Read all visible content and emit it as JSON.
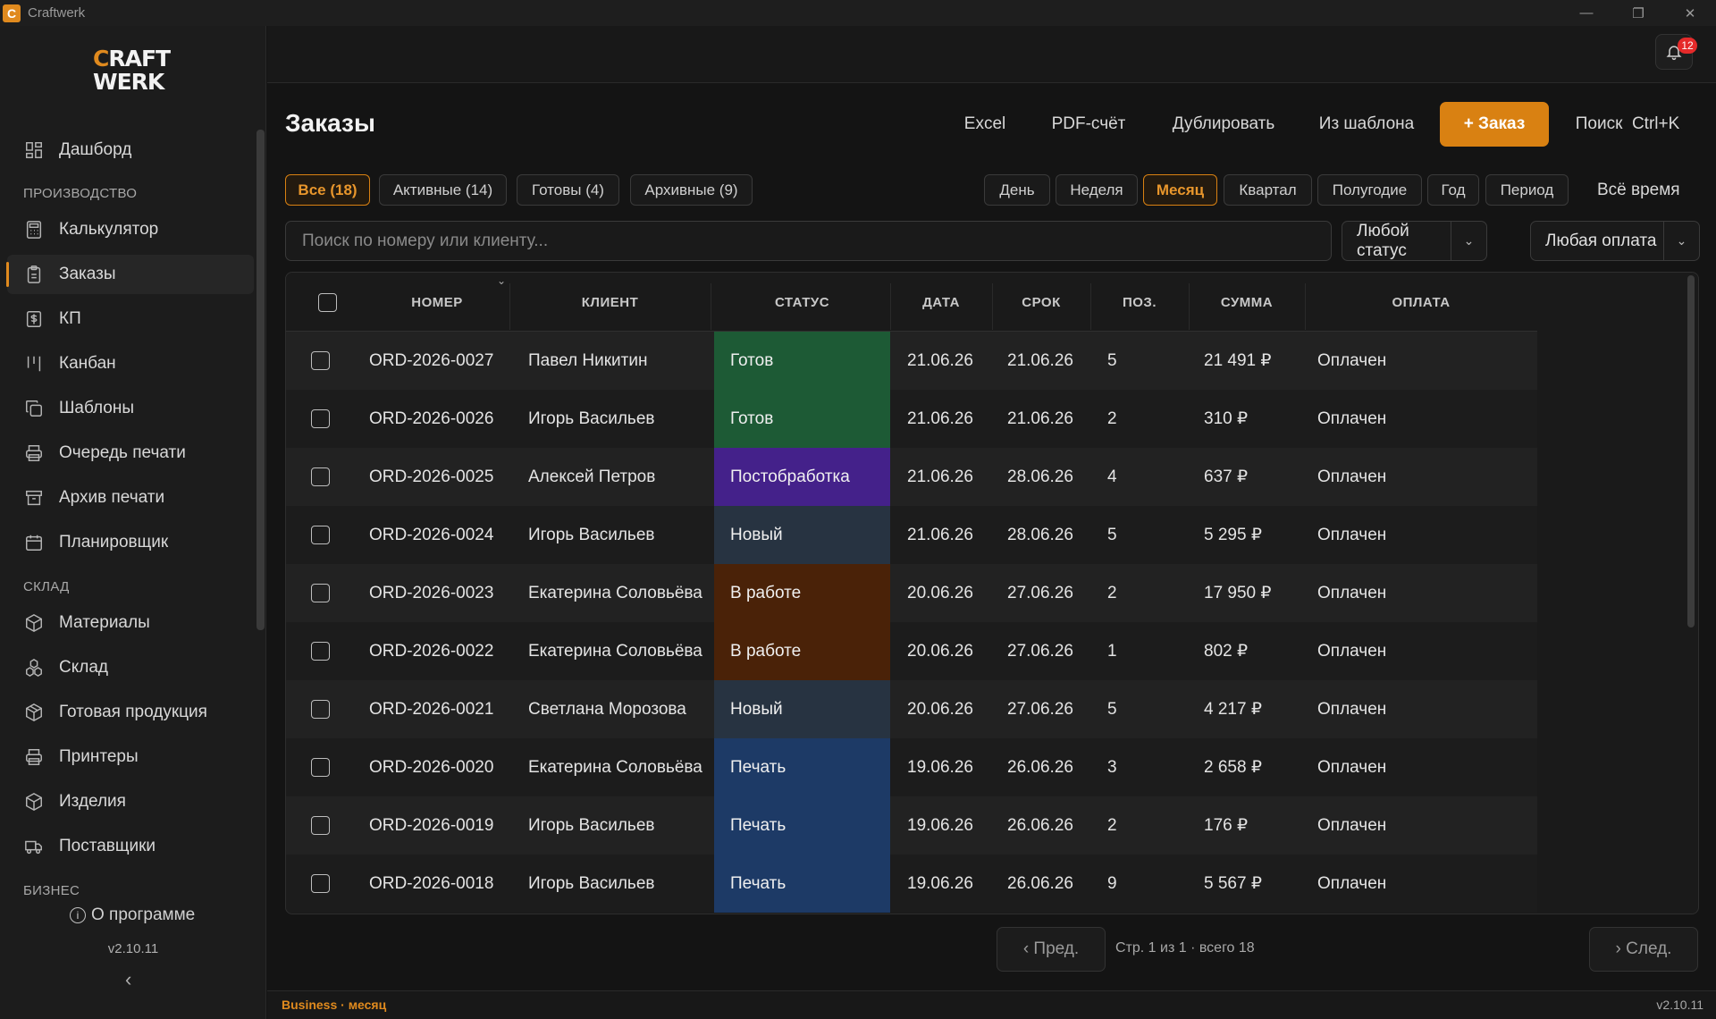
{
  "app": {
    "title": "Craftwerk",
    "icon_letter": "C"
  },
  "window_controls": {
    "minimize": "—",
    "maximize": "❐",
    "close": "✕"
  },
  "logo": {
    "line1_accent": "C",
    "line1_rest": "RAFT",
    "line2": "WERK"
  },
  "sidebar": {
    "dashboard": "Дашборд",
    "sections": {
      "production": "ПРОИЗВОДСТВО",
      "warehouse": "СКЛАД",
      "business": "БИЗНЕС"
    },
    "items": [
      {
        "label": "Калькулятор",
        "icon": "calculator-icon"
      },
      {
        "label": "Заказы",
        "icon": "clipboard-icon",
        "active": true
      },
      {
        "label": "КП",
        "icon": "dollar-doc-icon"
      },
      {
        "label": "Канбан",
        "icon": "kanban-icon"
      },
      {
        "label": "Шаблоны",
        "icon": "copy-icon"
      },
      {
        "label": "Очередь печати",
        "icon": "printer-icon"
      },
      {
        "label": "Архив печати",
        "icon": "archive-icon"
      },
      {
        "label": "Планировщик",
        "icon": "calendar-icon"
      },
      {
        "label": "Материалы",
        "icon": "box-icon"
      },
      {
        "label": "Склад",
        "icon": "boxes-icon"
      },
      {
        "label": "Готовая продукция",
        "icon": "package-icon"
      },
      {
        "label": "Принтеры",
        "icon": "printer-icon"
      },
      {
        "label": "Изделия",
        "icon": "cube-icon"
      },
      {
        "label": "Поставщики",
        "icon": "truck-icon"
      }
    ],
    "about": "О программе",
    "version": "v2.10.11"
  },
  "notifications": {
    "count": "12"
  },
  "header": {
    "title": "Заказы",
    "actions": {
      "excel": "Excel",
      "pdf": "PDF-счёт",
      "duplicate": "Дублировать",
      "from_template": "Из шаблона",
      "new_order": "+ Заказ",
      "search": "Поиск  Ctrl+K"
    }
  },
  "filters": {
    "tabs": [
      "Все (18)",
      "Активные (14)",
      "Готовы (4)",
      "Архивные (9)"
    ],
    "active_tab": "Все (18)",
    "periods": [
      "День",
      "Неделя",
      "Месяц",
      "Квартал",
      "Полугодие",
      "Год",
      "Период"
    ],
    "active_period": "Месяц",
    "all_time": "Всё время"
  },
  "search": {
    "placeholder": "Поиск по номеру или клиенту..."
  },
  "status_select": {
    "value": "Любой статус"
  },
  "payment_select": {
    "value": "Любая оплата"
  },
  "table": {
    "columns": [
      "НОМЕР",
      "КЛИЕНТ",
      "СТАТУС",
      "ДАТА",
      "СРОК",
      "ПОЗ.",
      "СУММА",
      "ОПЛАТА"
    ],
    "status_colors": {
      "Готов": "#1d5a35",
      "Постобработка": "#44218a",
      "Новый": "#273341",
      "В работе": "#4a2208",
      "Печать": "#1d3a66"
    },
    "rows": [
      {
        "number": "ORD-2026-0027",
        "client": "Павел Никитин",
        "status": "Готов",
        "date": "21.06.26",
        "due": "21.06.26",
        "pos": "5",
        "sum": "21 491 ₽",
        "payment": "Оплачен"
      },
      {
        "number": "ORD-2026-0026",
        "client": "Игорь Васильев",
        "status": "Готов",
        "date": "21.06.26",
        "due": "21.06.26",
        "pos": "2",
        "sum": "310 ₽",
        "payment": "Оплачен"
      },
      {
        "number": "ORD-2026-0025",
        "client": "Алексей Петров",
        "status": "Постобработка",
        "date": "21.06.26",
        "due": "28.06.26",
        "pos": "4",
        "sum": "637 ₽",
        "payment": "Оплачен"
      },
      {
        "number": "ORD-2026-0024",
        "client": "Игорь Васильев",
        "status": "Новый",
        "date": "21.06.26",
        "due": "28.06.26",
        "pos": "5",
        "sum": "5 295 ₽",
        "payment": "Оплачен"
      },
      {
        "number": "ORD-2026-0023",
        "client": "Екатерина Соловьёва",
        "status": "В работе",
        "date": "20.06.26",
        "due": "27.06.26",
        "pos": "2",
        "sum": "17 950 ₽",
        "payment": "Оплачен"
      },
      {
        "number": "ORD-2026-0022",
        "client": "Екатерина Соловьёва",
        "status": "В работе",
        "date": "20.06.26",
        "due": "27.06.26",
        "pos": "1",
        "sum": "802 ₽",
        "payment": "Оплачен"
      },
      {
        "number": "ORD-2026-0021",
        "client": "Светлана Морозова",
        "status": "Новый",
        "date": "20.06.26",
        "due": "27.06.26",
        "pos": "5",
        "sum": "4 217 ₽",
        "payment": "Оплачен"
      },
      {
        "number": "ORD-2026-0020",
        "client": "Екатерина Соловьёва",
        "status": "Печать",
        "date": "19.06.26",
        "due": "26.06.26",
        "pos": "3",
        "sum": "2 658 ₽",
        "payment": "Оплачен"
      },
      {
        "number": "ORD-2026-0019",
        "client": "Игорь Васильев",
        "status": "Печать",
        "date": "19.06.26",
        "due": "26.06.26",
        "pos": "2",
        "sum": "176 ₽",
        "payment": "Оплачен"
      },
      {
        "number": "ORD-2026-0018",
        "client": "Игорь Васильев",
        "status": "Печать",
        "date": "19.06.26",
        "due": "26.06.26",
        "pos": "9",
        "sum": "5 567 ₽",
        "payment": "Оплачен"
      }
    ]
  },
  "pagination": {
    "prev": "‹ Пред.",
    "next": "› След.",
    "info": "Стр. 1 из 1 · всего 18"
  },
  "statusbar": {
    "plan": "Business · месяц",
    "version": "v2.10.11"
  }
}
